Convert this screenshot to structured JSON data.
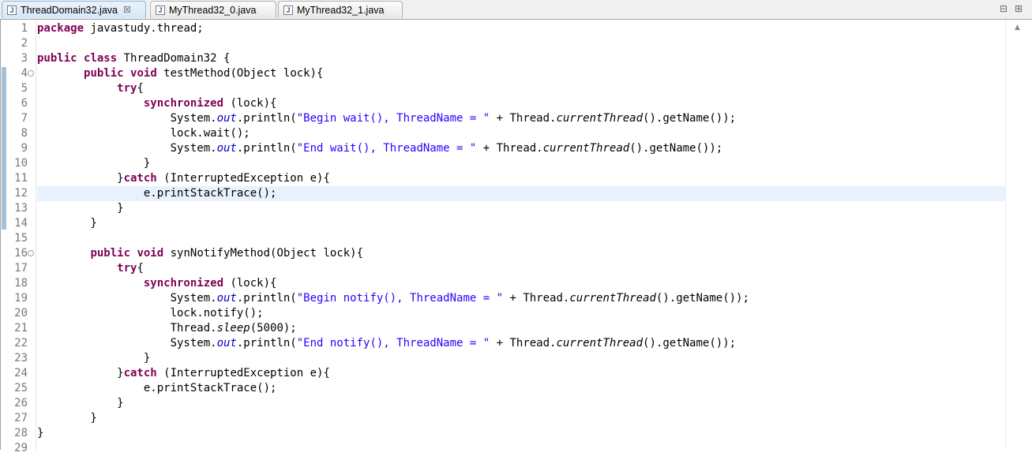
{
  "tabs": [
    {
      "label": "ThreadDomain32.java",
      "active": true,
      "close": "☒"
    },
    {
      "label": "MyThread32_0.java",
      "active": false
    },
    {
      "label": "MyThread32_1.java",
      "active": false
    }
  ],
  "window_controls": {
    "minimize": "⊟",
    "maximize": "⊞"
  },
  "current_line": 12,
  "line_numbers": [
    "1",
    "2",
    "3",
    "4",
    "5",
    "6",
    "7",
    "8",
    "9",
    "10",
    "11",
    "12",
    "13",
    "14",
    "15",
    "16",
    "17",
    "18",
    "19",
    "20",
    "21",
    "22",
    "23",
    "24",
    "25",
    "26",
    "27",
    "28",
    "29"
  ],
  "fold_markers": [
    {
      "line": 4,
      "symbol": "⊖"
    },
    {
      "line": 16,
      "symbol": "⊖"
    }
  ],
  "code_lines": [
    [
      {
        "t": "kw",
        "v": "package"
      },
      {
        "t": "plain",
        "v": " javastudy.thread;"
      }
    ],
    [],
    [
      {
        "t": "kw",
        "v": "public"
      },
      {
        "t": "plain",
        "v": " "
      },
      {
        "t": "kw",
        "v": "class"
      },
      {
        "t": "plain",
        "v": " ThreadDomain32 {"
      }
    ],
    [
      {
        "t": "plain",
        "v": "       "
      },
      {
        "t": "kw",
        "v": "public"
      },
      {
        "t": "plain",
        "v": " "
      },
      {
        "t": "kw",
        "v": "void"
      },
      {
        "t": "plain",
        "v": " testMethod(Object lock){"
      }
    ],
    [
      {
        "t": "plain",
        "v": "            "
      },
      {
        "t": "kw",
        "v": "try"
      },
      {
        "t": "plain",
        "v": "{"
      }
    ],
    [
      {
        "t": "plain",
        "v": "                "
      },
      {
        "t": "kw",
        "v": "synchronized"
      },
      {
        "t": "plain",
        "v": " (lock){"
      }
    ],
    [
      {
        "t": "plain",
        "v": "                    System."
      },
      {
        "t": "fld",
        "v": "out"
      },
      {
        "t": "plain",
        "v": ".println("
      },
      {
        "t": "str",
        "v": "\"Begin wait(), ThreadName = \""
      },
      {
        "t": "plain",
        "v": " + Thread."
      },
      {
        "t": "stm",
        "v": "currentThread"
      },
      {
        "t": "plain",
        "v": "().getName());"
      }
    ],
    [
      {
        "t": "plain",
        "v": "                    lock.wait();"
      }
    ],
    [
      {
        "t": "plain",
        "v": "                    System."
      },
      {
        "t": "fld",
        "v": "out"
      },
      {
        "t": "plain",
        "v": ".println("
      },
      {
        "t": "str",
        "v": "\"End wait(), ThreadName = \""
      },
      {
        "t": "plain",
        "v": " + Thread."
      },
      {
        "t": "stm",
        "v": "currentThread"
      },
      {
        "t": "plain",
        "v": "().getName());"
      }
    ],
    [
      {
        "t": "plain",
        "v": "                }"
      }
    ],
    [
      {
        "t": "plain",
        "v": "            }"
      },
      {
        "t": "kw",
        "v": "catch"
      },
      {
        "t": "plain",
        "v": " (InterruptedException e){"
      }
    ],
    [
      {
        "t": "plain",
        "v": "                e.printStackTrace();"
      }
    ],
    [
      {
        "t": "plain",
        "v": "            }"
      }
    ],
    [
      {
        "t": "plain",
        "v": "        }"
      }
    ],
    [],
    [
      {
        "t": "plain",
        "v": "        "
      },
      {
        "t": "kw",
        "v": "public"
      },
      {
        "t": "plain",
        "v": " "
      },
      {
        "t": "kw",
        "v": "void"
      },
      {
        "t": "plain",
        "v": " synNotifyMethod(Object lock){"
      }
    ],
    [
      {
        "t": "plain",
        "v": "            "
      },
      {
        "t": "kw",
        "v": "try"
      },
      {
        "t": "plain",
        "v": "{"
      }
    ],
    [
      {
        "t": "plain",
        "v": "                "
      },
      {
        "t": "kw",
        "v": "synchronized"
      },
      {
        "t": "plain",
        "v": " (lock){"
      }
    ],
    [
      {
        "t": "plain",
        "v": "                    System."
      },
      {
        "t": "fld",
        "v": "out"
      },
      {
        "t": "plain",
        "v": ".println("
      },
      {
        "t": "str",
        "v": "\"Begin notify(), ThreadName = \""
      },
      {
        "t": "plain",
        "v": " + Thread."
      },
      {
        "t": "stm",
        "v": "currentThread"
      },
      {
        "t": "plain",
        "v": "().getName());"
      }
    ],
    [
      {
        "t": "plain",
        "v": "                    lock.notify();"
      }
    ],
    [
      {
        "t": "plain",
        "v": "                    Thread."
      },
      {
        "t": "stm",
        "v": "sleep"
      },
      {
        "t": "plain",
        "v": "(5000);"
      }
    ],
    [
      {
        "t": "plain",
        "v": "                    System."
      },
      {
        "t": "fld",
        "v": "out"
      },
      {
        "t": "plain",
        "v": ".println("
      },
      {
        "t": "str",
        "v": "\"End notify(), ThreadName = \""
      },
      {
        "t": "plain",
        "v": " + Thread."
      },
      {
        "t": "stm",
        "v": "currentThread"
      },
      {
        "t": "plain",
        "v": "().getName());"
      }
    ],
    [
      {
        "t": "plain",
        "v": "                }"
      }
    ],
    [
      {
        "t": "plain",
        "v": "            }"
      },
      {
        "t": "kw",
        "v": "catch"
      },
      {
        "t": "plain",
        "v": " (InterruptedException e){"
      }
    ],
    [
      {
        "t": "plain",
        "v": "                e.printStackTrace();"
      }
    ],
    [
      {
        "t": "plain",
        "v": "            }"
      }
    ],
    [
      {
        "t": "plain",
        "v": "        }"
      }
    ],
    [
      {
        "t": "plain",
        "v": "}"
      }
    ],
    []
  ],
  "colors": {
    "keyword": "#7f0055",
    "string": "#2a00ff",
    "field": "#0000c0",
    "current_line": "#e8f2fe",
    "change_bar": "#a5c1d8"
  }
}
